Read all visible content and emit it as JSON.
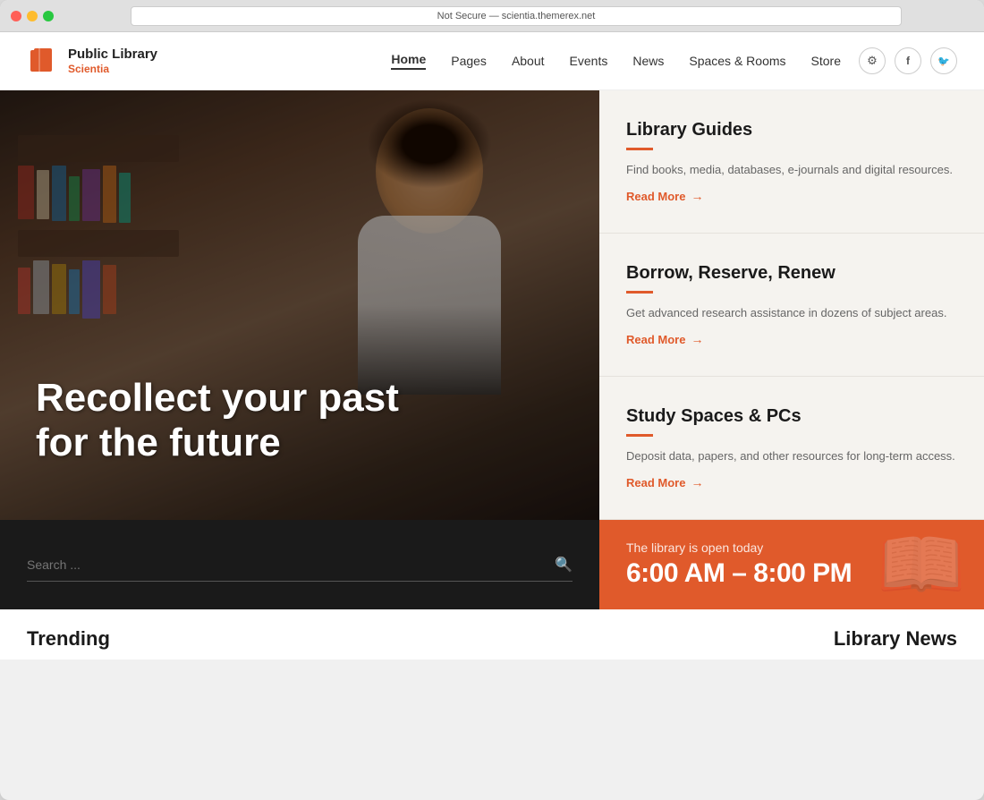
{
  "browser": {
    "address": "Not Secure — scientia.themerex.net",
    "buttons": [
      "red",
      "yellow",
      "green"
    ]
  },
  "header": {
    "logo": {
      "title": "Public Library",
      "subtitle": "Scientia"
    },
    "nav": [
      {
        "label": "Home",
        "active": true
      },
      {
        "label": "Pages",
        "active": false
      },
      {
        "label": "About",
        "active": false
      },
      {
        "label": "Events",
        "active": false
      },
      {
        "label": "News",
        "active": false
      },
      {
        "label": "Spaces & Rooms",
        "active": false
      },
      {
        "label": "Store",
        "active": false
      }
    ],
    "icons": [
      "gear",
      "facebook",
      "twitter"
    ]
  },
  "hero": {
    "headline_line1": "Recollect your past",
    "headline_line2": "for the future"
  },
  "guides": [
    {
      "title": "Library Guides",
      "description": "Find books, media, databases, e-journals and digital resources.",
      "read_more": "Read More"
    },
    {
      "title": "Borrow, Reserve, Renew",
      "description": "Get advanced research assistance in dozens of subject areas.",
      "read_more": "Read More"
    },
    {
      "title": "Study Spaces & PCs",
      "description": "Deposit data, papers, and other resources for long-term access.",
      "read_more": "Read More"
    }
  ],
  "search": {
    "placeholder": "Search ..."
  },
  "hours": {
    "label": "The library is open today",
    "time": "6:00 AM – 8:00 PM"
  },
  "bottom": {
    "trending_label": "Trending",
    "library_news_label": "Library News"
  },
  "colors": {
    "accent": "#e05a2b",
    "dark": "#1a1a1a",
    "light_bg": "#f5f3ef"
  }
}
